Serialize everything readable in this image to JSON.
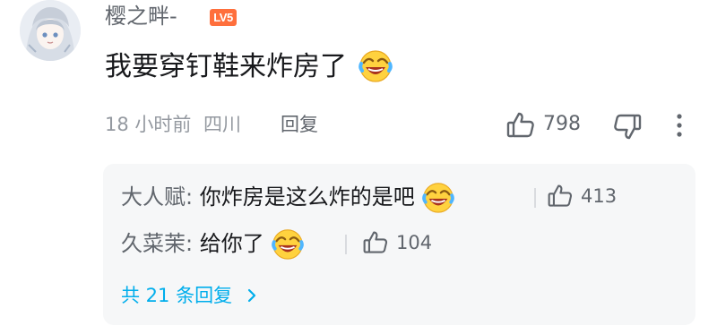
{
  "comment": {
    "username": "樱之畔-",
    "level": "LV5",
    "text": "我要穿钉鞋来炸房了",
    "emoji": "laughing-crying-emoji",
    "time": "18 小时前",
    "location": "四川",
    "reply_label": "回复",
    "like_count": "798"
  },
  "replies": [
    {
      "name": "大人赋:",
      "text": "你炸房是这么炸的是吧",
      "emoji": "laughing-crying-emoji",
      "like_count": "413"
    },
    {
      "name": "久菜茉:",
      "text": "给你了",
      "emoji": "laughing-crying-emoji",
      "like_count": "104"
    }
  ],
  "total_replies_label": "共 21 条回复",
  "colors": {
    "accent": "#00aeec",
    "level_badge": "#ff6f3c",
    "reply_bg": "#f6f7f8",
    "secondary_text": "#9499a0"
  },
  "icons": {
    "like": "thumb-up-icon",
    "dislike": "thumb-down-icon",
    "more": "more-vertical-icon",
    "chevron": "chevron-right-icon"
  }
}
